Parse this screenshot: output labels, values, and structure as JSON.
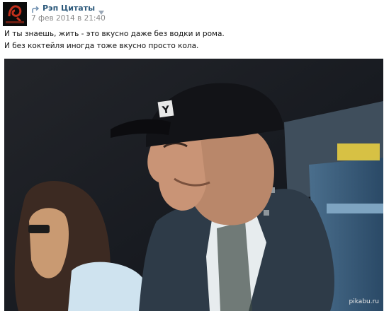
{
  "post": {
    "author": "Рэп Цитаты",
    "date": "7 фев 2014 в 21:40",
    "text_lines": [
      "И ты знаешь, жить - это вкусно даже без водки и рома.",
      "И без коктейля иногда тоже вкусно просто кола."
    ],
    "avatar_icon": "community-logo-icon",
    "repost_icon": "repost-arrow-icon",
    "menu_icon": "dropdown-triangle-icon"
  },
  "photo": {
    "description_icon": "photo-image",
    "watermark": "pikabu.ru",
    "cap_letter": "Y"
  },
  "colors": {
    "link": "#2b587a",
    "date": "#8a8a8a",
    "text": "#111111"
  }
}
